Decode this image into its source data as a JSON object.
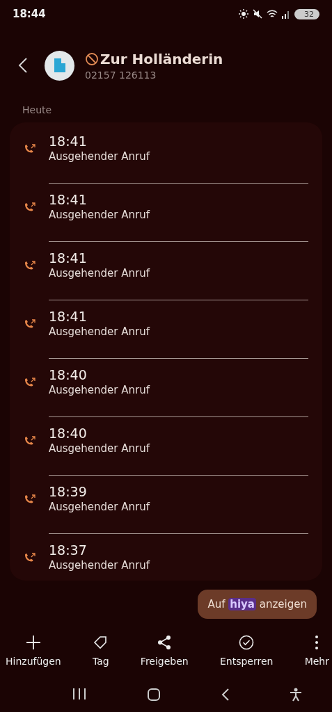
{
  "status_bar": {
    "time": "18:44",
    "battery": "32"
  },
  "header": {
    "name": "Zur Holländerin",
    "number": "02157 126113",
    "blocked": true
  },
  "section": "Heute",
  "calls": [
    {
      "time": "18:41",
      "type": "Ausgehender Anruf"
    },
    {
      "time": "18:41",
      "type": "Ausgehender Anruf"
    },
    {
      "time": "18:41",
      "type": "Ausgehender Anruf"
    },
    {
      "time": "18:41",
      "type": "Ausgehender Anruf"
    },
    {
      "time": "18:40",
      "type": "Ausgehender Anruf"
    },
    {
      "time": "18:40",
      "type": "Ausgehender Anruf"
    },
    {
      "time": "18:39",
      "type": "Ausgehender Anruf"
    },
    {
      "time": "18:37",
      "type": "Ausgehender Anruf"
    }
  ],
  "lookup_button": {
    "prefix": "Auf",
    "brand": "hiya",
    "suffix": "anzeigen"
  },
  "actions": [
    {
      "kind": "add",
      "label": "Hinzufügen"
    },
    {
      "kind": "tag",
      "label": "Tag"
    },
    {
      "kind": "share",
      "label": "Freigeben"
    },
    {
      "kind": "unblock",
      "label": "Entsperren"
    },
    {
      "kind": "more",
      "label": "Mehr"
    }
  ]
}
